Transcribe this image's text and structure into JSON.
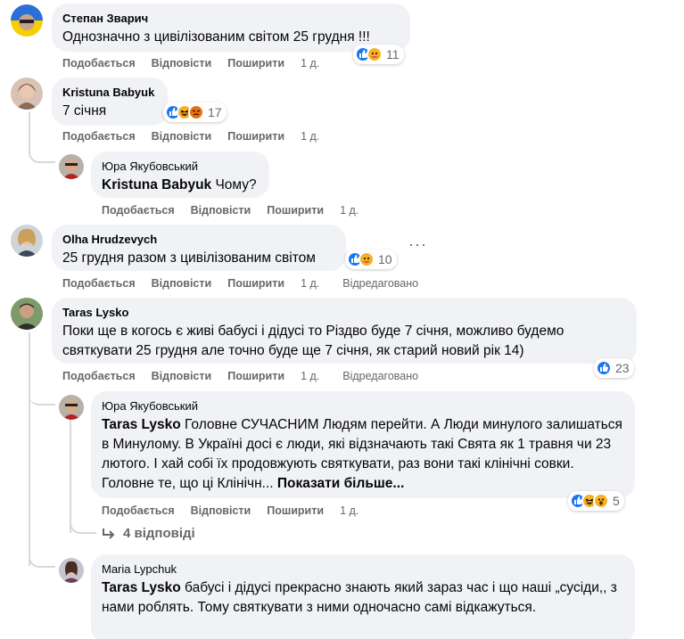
{
  "actions": {
    "like": "Подобається",
    "reply": "Відповісти",
    "share": "Поширити",
    "edited": "Відредаговано"
  },
  "comments": [
    {
      "author": "Степан Зварич",
      "text": "Однозначно з цивілізованим світом 25 грудня !!!",
      "time": "1 д.",
      "reactions_count": "11"
    },
    {
      "author": "Kristuna Babyuk",
      "text": "7 січня",
      "time": "1 д.",
      "reactions_count": "17"
    },
    {
      "author": "Юра Якубовський",
      "mention": "Kristuna Babyuk",
      "text": " Чому?",
      "time": "1 д."
    },
    {
      "author": "Olha Hrudzevych",
      "text": "25 грудня разом з цивілізованим світом",
      "time": "1 д.",
      "reactions_count": "10"
    },
    {
      "author": "Taras Lysko",
      "text": "Поки ще в когось є живі бабусі і дідусі то Різдво буде 7 січня, можливо будемо святкувати 25 грудня але точно буде ще 7 січня, як старий новий рік 14)",
      "time": "1 д.",
      "reactions_count": "23"
    },
    {
      "author": "Юра Якубовський",
      "mention": "Taras Lysko",
      "text": " Головне СУЧАСНИМ Людям перейти. А Люди минулого залишаться в Минулому. В Україні досі є люди, які відзначають такі Свята як 1 травня чи 23 лютого. І хай собі їх продовжують святкувати, раз вони такі клінічні совки. Головне те, що ці Клінічн...",
      "see_more": "Показати більше...",
      "time": "1 д.",
      "reactions_count": "5"
    },
    {
      "author": "Maria Lypchuk",
      "mention": "Taras Lysko",
      "text": " бабусі і дідусі прекрасно знають який зараз час і що наші „сусіди,, з нами роблять. Тому святкувати з ними одночасно самі відкажуться."
    }
  ],
  "replies_link": "4 відповіді",
  "colors": {
    "bubble": "#f0f2f5",
    "secondary_text": "#65676b",
    "like_blue": "#1877f2",
    "haha_yellow": "#f7b125",
    "angry_orange": "#e9710f"
  }
}
